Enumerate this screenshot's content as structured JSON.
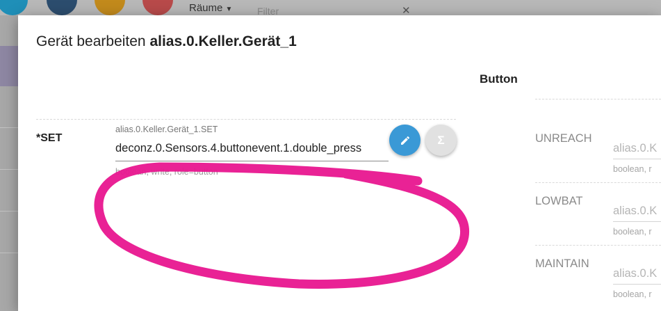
{
  "background": {
    "toolbar": {
      "rooms_label": "Räume",
      "filter_placeholder": "Filter",
      "clear_glyph": "✕"
    }
  },
  "dialog": {
    "title_prefix": "Gerät bearbeiten",
    "title_id": "alias.0.Keller.Gerät_1",
    "column_header": "Button",
    "fields": [
      {
        "label": "*SET",
        "id_label": "alias.0.Keller.Gerät_1.SET",
        "value": "deconz.0.Sensors.4.buttonevent.1.double_press",
        "helper": "boolean, write, role=button"
      }
    ],
    "edit_button_icon": "pencil-icon",
    "formula_button_glyph": "Σ",
    "right_fields": [
      {
        "label": "UNREACH",
        "value": "alias.0.K",
        "helper": "boolean, r"
      },
      {
        "label": "LOWBAT",
        "value": "alias.0.K",
        "helper": "boolean, r"
      },
      {
        "label": "MAINTAIN",
        "value": "alias.0.K",
        "helper": "boolean, r"
      }
    ]
  },
  "annotation": {
    "color": "#e8168f"
  },
  "colors": {
    "edit_fab": "#3a99d6",
    "formula_fab": "#e1e1e1"
  }
}
